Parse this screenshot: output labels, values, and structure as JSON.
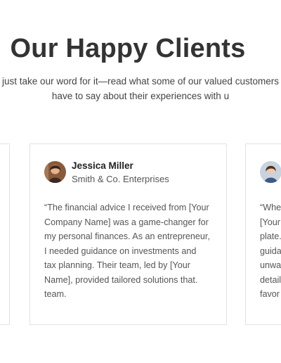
{
  "section": {
    "title": "Our Happy Clients",
    "subtitle_lines": [
      "just take our word for it—read what some of our valued customers",
      "have to say about their experiences with u"
    ]
  },
  "testimonials": [
    {
      "name": "Jessica Miller",
      "company": "Smith & Co. Enterprises",
      "quote_lines": [
        "“The financial advice I received from [Your",
        "Company Name] was a game-changer for",
        "my personal finances. As an entrepreneur,",
        "I needed guidance on investments and",
        "tax planning. Their team, led by [Your",
        "Name], provided tailored solutions that.",
        "team."
      ]
    },
    {
      "quote_lines": [
        "“Whe",
        "[Your",
        "plate.",
        "guida",
        "unwa",
        "detail",
        "favor"
      ]
    }
  ],
  "colors": {
    "title": "#333333",
    "card_border": "#e3e3e3",
    "text_muted": "#555555"
  }
}
